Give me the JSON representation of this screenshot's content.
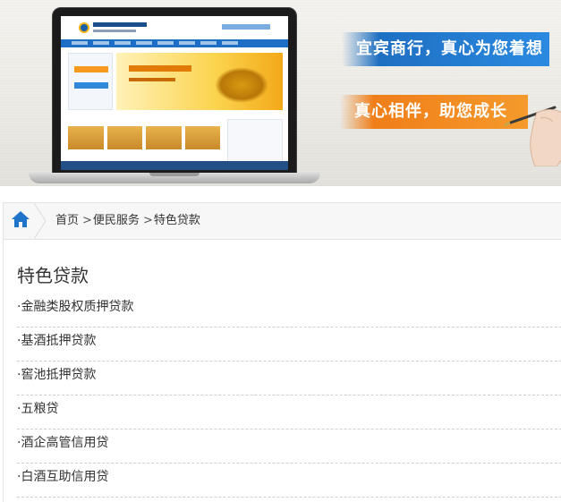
{
  "banner": {
    "slogan_1": "宜宾商行，真心为您着想",
    "slogan_2": "真心相伴，助您成长",
    "colors": {
      "slogan_1_bg": "#1e6fc2",
      "slogan_2_bg": "#f07e18"
    }
  },
  "breadcrumb": {
    "home_icon": "home-icon",
    "separator": ">",
    "items": [
      "首页",
      "便民服务",
      "特色贷款"
    ]
  },
  "main": {
    "title": "特色贷款",
    "loans": [
      "·金融类股权质押贷款",
      "·基酒抵押贷款",
      "·窖池抵押贷款",
      "·五粮贷",
      "·酒企高管信用贷",
      "·白酒互助信用贷"
    ]
  },
  "colors": {
    "accent_blue": "#1c6fc4",
    "home_icon": "#1f74c9",
    "divider": "#cfcfcf"
  }
}
